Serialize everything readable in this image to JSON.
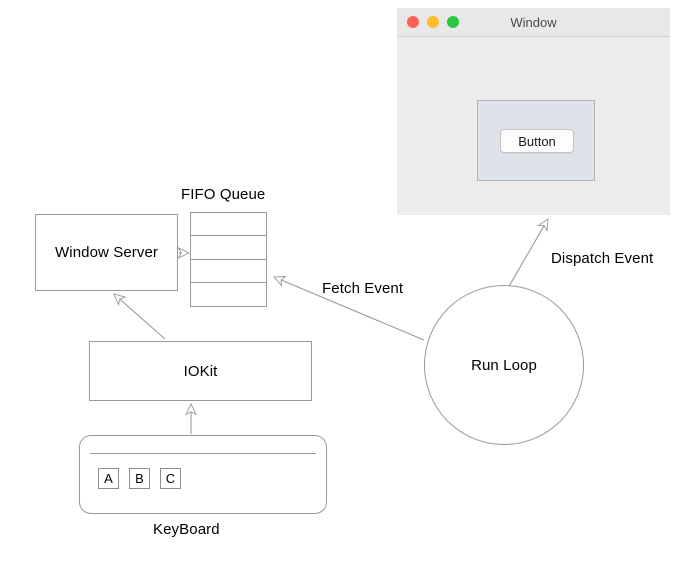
{
  "diagram": {
    "title": "macOS event flow diagram",
    "nodes": {
      "window_server": "Window Server",
      "fifo_queue_title": "FIFO Queue",
      "iokit": "IOKit",
      "keyboard_label": "KeyBoard",
      "run_loop": "Run Loop"
    },
    "queue_cells": [
      "",
      "",
      "",
      ""
    ],
    "keyboard_keys": [
      "A",
      "B",
      "C"
    ],
    "edges": [
      {
        "name": "window-server-to-queue",
        "label": "",
        "from": "Window Server",
        "to": "FIFO Queue"
      },
      {
        "name": "iokit-to-window-server",
        "label": "",
        "from": "IOKit",
        "to": "Window Server"
      },
      {
        "name": "keyboard-to-iokit",
        "label": "",
        "from": "KeyBoard",
        "to": "IOKit"
      },
      {
        "name": "run-loop-to-queue",
        "label": "Fetch Event",
        "from": "Run Loop",
        "to": "FIFO Queue"
      },
      {
        "name": "run-loop-to-window",
        "label": "Dispatch Event",
        "from": "Run Loop",
        "to": "Window"
      }
    ],
    "edge_labels": {
      "fetch_event": "Fetch Event",
      "dispatch_event": "Dispatch Event"
    },
    "colors": {
      "stroke": "#9a9a9a",
      "text": "#000000",
      "node_fill": "#ffffff"
    }
  },
  "window": {
    "title": "Window",
    "button_label": "Button",
    "traffic_lights": [
      {
        "name": "close",
        "color": "#ff5f57"
      },
      {
        "name": "minimize",
        "color": "#ffbd2e"
      },
      {
        "name": "zoom",
        "color": "#28c840"
      }
    ],
    "colors": {
      "chrome": "#ececec",
      "titlebar": "#e8e8e8",
      "panel": "#dee2e9",
      "button": "#fdfdfd"
    }
  }
}
